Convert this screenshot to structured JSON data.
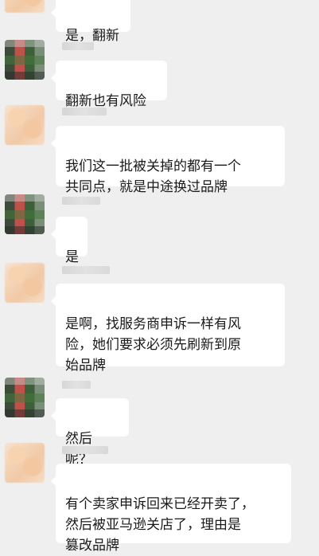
{
  "messages": [
    {
      "text": "是，翻新",
      "avatar": "peach"
    },
    {
      "text": "翻新也有风险",
      "avatar": "dark"
    },
    {
      "text": "我们这一批被关掉的都有一个\n共同点，就是中途换过品牌",
      "avatar": "peach"
    },
    {
      "text": "是",
      "avatar": "dark"
    },
    {
      "text": "是啊，找服务商申诉一样有风\n险，她们要求必须先刷新到原\n始品牌",
      "avatar": "peach"
    },
    {
      "text": "然后呢？",
      "avatar": "dark"
    },
    {
      "text": "有个卖家申诉回来已经开卖了，\n然后被亚马逊关店了，理由是\n篡改品牌",
      "avatar": "peach"
    }
  ]
}
